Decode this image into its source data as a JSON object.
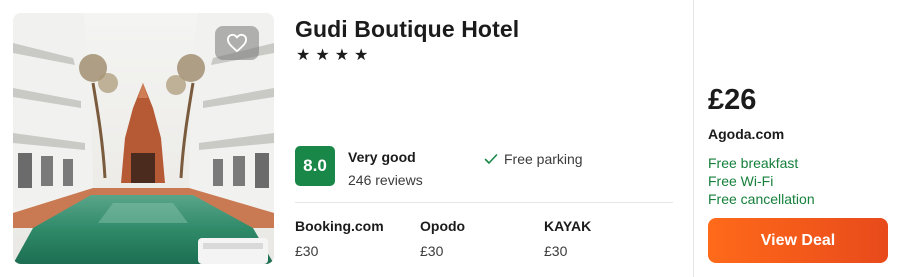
{
  "hotel": {
    "name": "Gudi Boutique Hotel",
    "stars": "★★★★",
    "photo_icon": "hotel-courtyard-photo",
    "favorite_icon": "heart-icon"
  },
  "rating": {
    "score": "8.0",
    "label": "Very good",
    "reviews": "246 reviews",
    "badge_color": "#198748"
  },
  "amenities": [
    {
      "label": "Free parking",
      "icon": "check-icon"
    }
  ],
  "providers": [
    {
      "name": "Booking.com",
      "price": "£30"
    },
    {
      "name": "Opodo",
      "price": "£30"
    },
    {
      "name": "KAYAK",
      "price": "£30"
    }
  ],
  "deal": {
    "price": "£26",
    "site": "Agoda.com",
    "perks": [
      "Free breakfast",
      "Free Wi-Fi",
      "Free cancellation"
    ],
    "perk_color": "#16803c",
    "button_label": "View Deal",
    "button_color": "#ff6a1a"
  }
}
